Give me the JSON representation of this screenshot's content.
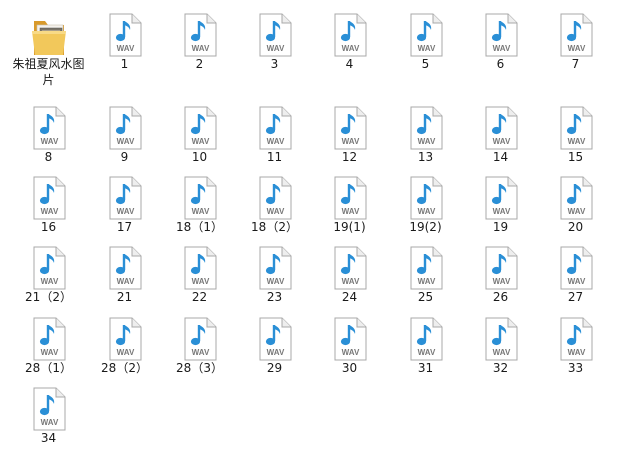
{
  "folder": {
    "name": "朱祖夏风水图片",
    "icon": "folder-icon",
    "color": "#E8B84A"
  },
  "file_type_badge": "WAV",
  "file_icon": "wav-audio-file-icon",
  "note_color": "#2A8FD6",
  "files": [
    "1",
    "2",
    "3",
    "4",
    "5",
    "6",
    "7",
    "8",
    "9",
    "10",
    "11",
    "12",
    "13",
    "14",
    "15",
    "16",
    "17",
    "18（1）",
    "18（2）",
    "19(1)",
    "19(2)",
    "19",
    "20",
    "21（2）",
    "21",
    "22",
    "23",
    "24",
    "25",
    "26",
    "27",
    "28（1）",
    "28（2）",
    "28（3）",
    "29",
    "30",
    "31",
    "32",
    "33",
    "34"
  ]
}
